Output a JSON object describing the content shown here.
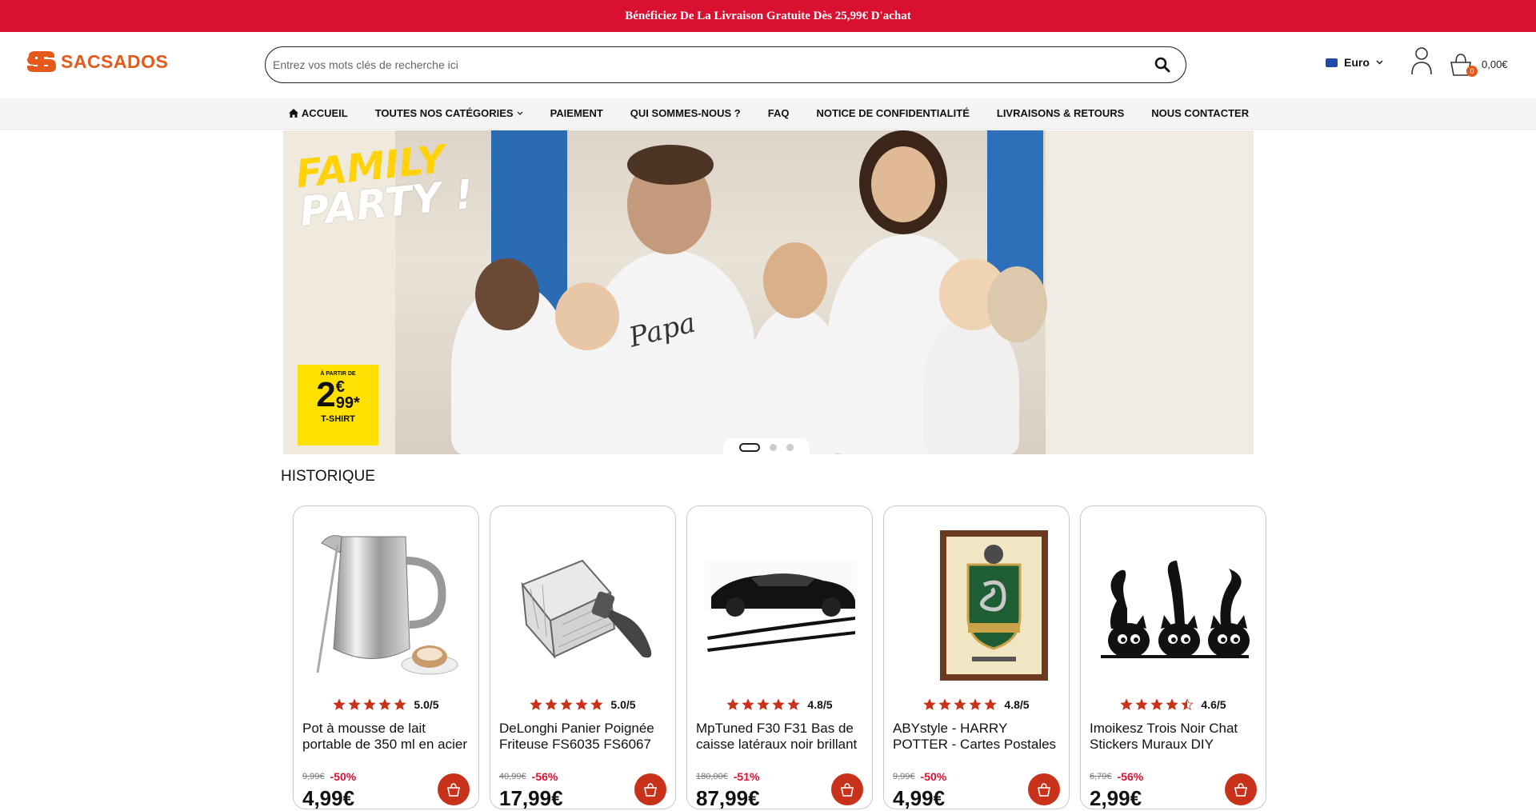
{
  "promo": {
    "text": "Bénéficiez De La Livraison Gratuite Dès 25,99€ D'achat"
  },
  "header": {
    "logo_text": "SACSADOS",
    "search_placeholder": "Entrez vos mots clés de recherche ici",
    "currency": "Euro",
    "cart_count": "0",
    "cart_total": "0,00€"
  },
  "nav": {
    "items": [
      {
        "label": "ACCUEIL",
        "icon": "home-icon"
      },
      {
        "label": "TOUTES NOS CATÉGORIES",
        "icon": "chevron-down-icon"
      },
      {
        "label": "PAIEMENT"
      },
      {
        "label": "QUI SOMMES-NOUS ?"
      },
      {
        "label": "FAQ"
      },
      {
        "label": "NOTICE DE CONFIDENTIALITÉ"
      },
      {
        "label": "LIVRAISONS & RETOURS"
      },
      {
        "label": "NOUS CONTACTER"
      }
    ]
  },
  "hero": {
    "title_line1": "FAMILY",
    "title_line2": "PARTY !",
    "price_prefix": "À PARTIR DE",
    "price_int": "2",
    "price_currency": "€",
    "price_cents": "99*",
    "price_label": "T-SHIRT",
    "shirt_text": "Papa",
    "slide_count": 3,
    "active_slide": 1
  },
  "section": {
    "title": "HISTORIQUE"
  },
  "products": [
    {
      "name": "Pot à mousse de lait portable de 350 ml en acier",
      "rating": "5.0/5",
      "stars": 5,
      "old_price": "9,99€",
      "discount": "-50%",
      "price": "4,99€",
      "image": "milk-pitcher-image"
    },
    {
      "name": "DeLonghi Panier Poignée Friteuse FS6035 FS6067",
      "rating": "5.0/5",
      "stars": 5,
      "old_price": "40,99€",
      "discount": "-56%",
      "price": "17,99€",
      "image": "fryer-basket-image"
    },
    {
      "name": "MpTuned F30 F31 Bas de caisse latéraux noir brillant",
      "rating": "4.8/5",
      "stars": 5,
      "old_price": "180,00€",
      "discount": "-51%",
      "price": "87,99€",
      "image": "car-side-skirts-image"
    },
    {
      "name": "ABYstyle - HARRY POTTER - Cartes Postales",
      "rating": "4.8/5",
      "stars": 5,
      "old_price": "9,99€",
      "discount": "-50%",
      "price": "4,99€",
      "image": "slytherin-poster-image"
    },
    {
      "name": "Imoikesz Trois Noir Chat Stickers Muraux DIY",
      "rating": "4.6/5",
      "stars": 4.5,
      "old_price": "6,79€",
      "discount": "-56%",
      "price": "2,99€",
      "image": "black-cats-sticker-image"
    }
  ],
  "colors": {
    "promo_bg": "#d9102f",
    "brand": "#e5591b",
    "star": "#c8321b",
    "discount": "#d9102f"
  }
}
